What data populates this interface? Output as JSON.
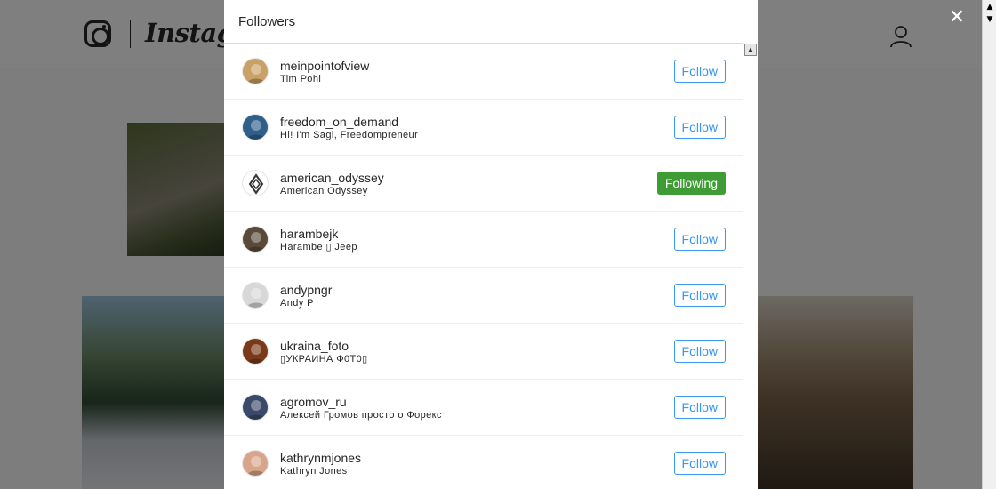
{
  "background": {
    "brand": "Instagram",
    "icons": [
      "instagram-glyph-icon",
      "profile-icon"
    ]
  },
  "modal": {
    "title": "Followers",
    "close_icon": "✕"
  },
  "followers": [
    {
      "username": "meinpointofview",
      "fullname": "Tim Pohl",
      "button": "Follow",
      "following": false,
      "avatar_color": "#c9a066"
    },
    {
      "username": "freedom_on_demand",
      "fullname": "Hi! I'm Sagi, Freedompreneur",
      "button": "Follow",
      "following": false,
      "avatar_color": "#2f5f8a"
    },
    {
      "username": "american_odyssey",
      "fullname": "American Odyssey",
      "button": "Following",
      "following": true,
      "avatar_color": "#ffffff"
    },
    {
      "username": "harambejk",
      "fullname": "Harambe ▯ Jeep",
      "button": "Follow",
      "following": false,
      "avatar_color": "#5a4a3a"
    },
    {
      "username": "andypngr",
      "fullname": "Andy P",
      "button": "Follow",
      "following": false,
      "avatar_color": "#d8d8d8"
    },
    {
      "username": "ukraina_foto",
      "fullname": "▯УКРАИНА Ф0Т0▯",
      "button": "Follow",
      "following": false,
      "avatar_color": "#7a3a1a"
    },
    {
      "username": "agromov_ru",
      "fullname": "Алексей Громов просто о Форекс",
      "button": "Follow",
      "following": false,
      "avatar_color": "#3a4a6a"
    },
    {
      "username": "kathrynmjones",
      "fullname": "Kathryn Jones",
      "button": "Follow",
      "following": false,
      "avatar_color": "#d9a58a"
    }
  ],
  "colors": {
    "follow_blue": "#3897f0",
    "following_green": "#3f9c35"
  }
}
